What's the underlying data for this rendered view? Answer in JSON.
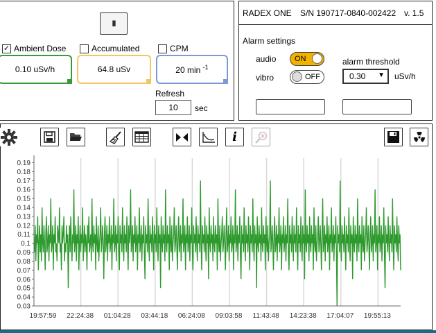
{
  "controls": {
    "pause_label": "II",
    "ambient": {
      "label": "Ambient Dose",
      "checked": true,
      "value": "0.10 uSv/h"
    },
    "accumulated": {
      "label": "Accumulated",
      "checked": false,
      "value": "64.8 uSv"
    },
    "cpm": {
      "label": "CPM",
      "checked": false,
      "value": "20 min",
      "value_sup": "-1"
    },
    "refresh": {
      "label": "Refresh",
      "value": "10",
      "unit": "sec"
    }
  },
  "device": {
    "name": "RADEX ONE",
    "serial": "S/N 190717-0840-002422",
    "version": "v. 1.5"
  },
  "alarm": {
    "title": "Alarm settings",
    "audio_label": "audio",
    "audio_state": "ON",
    "vibro_label": "vibro",
    "vibro_state": "OFF",
    "threshold_label": "alarm threshold",
    "threshold_value": "0.30",
    "threshold_unit": "uSv/h"
  },
  "toolbar": {
    "icons": [
      "gear-icon",
      "save-icon",
      "open-folder-icon",
      "broom-icon",
      "table-icon",
      "fit-icon",
      "curve-icon",
      "info-icon",
      "zoom-reset-icon",
      "save-dark-icon",
      "radiation-icon"
    ]
  },
  "colors": {
    "series": "#2e9a2e",
    "ambient_border": "#3a9a3a",
    "accum_border": "#f0c860",
    "cpm_border": "#7c9ad6",
    "toggle_on": "#f2b200"
  },
  "chart_data": {
    "type": "line",
    "title": "",
    "xlabel": "",
    "ylabel": "",
    "ylim": [
      0.03,
      0.195
    ],
    "y_ticks": [
      "0.19",
      "0.18",
      "0.17",
      "0.16",
      "0.15",
      "0.14",
      "0.13",
      "0.12",
      "0.11",
      "0.1",
      "0.09",
      "0.08",
      "0.07",
      "0.06",
      "0.05",
      "0.04",
      "0.03"
    ],
    "x_ticks": [
      "19:57:59",
      "22:24:38",
      "01:04:28",
      "03:44:18",
      "06:24:08",
      "09:03:58",
      "11:43:48",
      "14:23:38",
      "17:04:07",
      "19:55:13"
    ],
    "grid": "vertical",
    "series": [
      {
        "values": [
          0.1,
          0.09,
          0.12,
          0.08,
          0.11,
          0.1,
          0.13,
          0.07,
          0.1,
          0.12,
          0.09,
          0.11,
          0.08,
          0.14,
          0.1,
          0.09,
          0.12,
          0.1,
          0.07,
          0.11,
          0.13,
          0.09,
          0.1,
          0.12,
          0.08,
          0.11,
          0.1,
          0.15,
          0.09,
          0.1,
          0.12,
          0.07,
          0.11,
          0.1,
          0.13,
          0.09,
          0.1,
          0.08,
          0.12,
          0.11,
          0.1,
          0.14,
          0.09,
          0.1,
          0.07,
          0.12,
          0.1,
          0.11,
          0.13,
          0.08,
          0.1,
          0.09,
          0.12,
          0.1,
          0.11,
          0.05,
          0.1,
          0.12,
          0.09,
          0.13,
          0.1,
          0.08,
          0.11,
          0.1,
          0.16,
          0.09,
          0.1,
          0.12,
          0.08,
          0.11,
          0.1,
          0.13,
          0.07,
          0.1,
          0.12,
          0.09,
          0.11,
          0.1,
          0.14,
          0.08,
          0.1,
          0.12,
          0.09,
          0.11,
          0.1,
          0.07,
          0.12,
          0.1,
          0.13,
          0.09,
          0.1,
          0.11,
          0.08,
          0.15,
          0.1,
          0.09,
          0.12,
          0.1,
          0.11,
          0.07,
          0.13,
          0.1,
          0.09,
          0.12,
          0.08,
          0.1,
          0.11,
          0.14,
          0.09,
          0.1,
          0.12,
          0.1,
          0.06,
          0.11,
          0.13,
          0.09,
          0.1,
          0.12,
          0.08,
          0.11,
          0.1,
          0.13,
          0.09,
          0.1,
          0.12,
          0.07,
          0.11,
          0.1,
          0.15,
          0.09,
          0.1,
          0.12,
          0.08,
          0.11,
          0.1,
          0.13,
          0.09,
          0.07,
          0.12,
          0.1,
          0.11,
          0.09,
          0.14,
          0.1,
          0.08,
          0.12,
          0.1,
          0.11,
          0.09,
          0.13,
          0.1,
          0.07,
          0.12,
          0.1,
          0.11,
          0.16,
          0.09,
          0.1,
          0.12,
          0.08,
          0.11,
          0.1,
          0.13,
          0.09,
          0.1,
          0.12,
          0.07,
          0.11,
          0.1,
          0.14,
          0.09,
          0.1,
          0.12,
          0.08,
          0.11,
          0.1,
          0.13,
          0.09,
          0.06,
          0.12,
          0.1,
          0.11,
          0.09,
          0.15,
          0.1,
          0.08,
          0.12,
          0.1,
          0.11,
          0.09,
          0.13,
          0.1,
          0.07,
          0.12,
          0.1,
          0.11,
          0.09,
          0.14,
          0.1,
          0.08,
          0.12,
          0.1,
          0.11,
          0.05,
          0.13,
          0.1,
          0.09,
          0.12,
          0.1,
          0.11,
          0.08,
          0.16,
          0.1,
          0.09,
          0.12,
          0.1,
          0.11,
          0.07,
          0.13,
          0.1,
          0.09,
          0.12,
          0.08,
          0.1,
          0.11,
          0.14,
          0.09,
          0.1,
          0.12,
          0.1,
          0.07,
          0.11,
          0.13,
          0.09,
          0.1,
          0.12,
          0.08,
          0.11,
          0.1,
          0.15,
          0.09,
          0.1,
          0.12,
          0.07,
          0.11,
          0.1,
          0.13,
          0.09,
          0.1,
          0.12,
          0.08,
          0.11,
          0.1,
          0.14,
          0.09,
          0.07,
          0.12,
          0.1,
          0.11,
          0.09,
          0.13,
          0.1,
          0.08,
          0.12,
          0.1,
          0.11,
          0.09,
          0.17,
          0.1,
          0.07,
          0.12,
          0.1,
          0.11,
          0.09,
          0.13,
          0.1,
          0.08,
          0.12,
          0.1,
          0.11,
          0.06,
          0.14,
          0.1,
          0.09,
          0.12,
          0.1,
          0.11,
          0.08,
          0.13,
          0.1,
          0.09,
          0.12,
          0.1,
          0.11,
          0.07,
          0.15,
          0.1,
          0.09,
          0.12,
          0.08,
          0.1,
          0.11,
          0.13,
          0.09,
          0.1,
          0.12,
          0.1,
          0.07,
          0.11,
          0.14,
          0.09,
          0.1,
          0.12,
          0.08,
          0.11,
          0.1,
          0.13,
          0.09,
          0.1,
          0.12,
          0.07,
          0.11,
          0.1,
          0.16,
          0.09,
          0.1,
          0.12,
          0.08,
          0.11,
          0.1,
          0.13,
          0.09,
          0.06,
          0.12,
          0.1,
          0.11,
          0.09,
          0.14,
          0.1,
          0.08,
          0.12,
          0.1,
          0.11,
          0.09,
          0.13,
          0.1,
          0.07,
          0.12,
          0.1,
          0.11,
          0.09,
          0.15,
          0.1,
          0.08,
          0.12,
          0.1,
          0.11,
          0.05,
          0.13,
          0.1,
          0.09,
          0.12,
          0.1,
          0.11,
          0.08,
          0.14,
          0.1,
          0.09,
          0.12,
          0.1,
          0.11,
          0.07,
          0.13,
          0.1,
          0.09,
          0.12,
          0.08,
          0.1,
          0.11,
          0.17,
          0.09,
          0.1,
          0.12,
          0.1,
          0.07,
          0.11,
          0.13,
          0.09,
          0.1,
          0.12,
          0.08,
          0.11,
          0.1,
          0.14,
          0.09,
          0.1,
          0.12,
          0.07,
          0.11,
          0.1,
          0.13,
          0.09,
          0.1,
          0.12,
          0.08,
          0.11,
          0.1,
          0.15,
          0.09,
          0.07,
          0.12,
          0.1,
          0.11,
          0.09,
          0.13,
          0.1,
          0.08,
          0.12,
          0.1,
          0.11,
          0.09,
          0.14,
          0.1,
          0.07,
          0.12,
          0.1,
          0.11,
          0.09,
          0.13,
          0.1,
          0.08,
          0.12,
          0.1,
          0.11,
          0.06,
          0.16,
          0.1,
          0.09,
          0.12,
          0.1,
          0.11,
          0.08,
          0.13,
          0.1,
          0.09,
          0.12,
          0.1,
          0.11,
          0.07,
          0.14,
          0.1,
          0.09,
          0.12,
          0.08,
          0.1,
          0.11,
          0.13,
          0.09,
          0.1,
          0.12,
          0.1,
          0.07,
          0.11,
          0.15,
          0.09,
          0.1,
          0.12,
          0.08,
          0.11,
          0.1,
          0.13,
          0.09,
          0.1,
          0.12,
          0.07,
          0.11,
          0.1,
          0.14,
          0.09,
          0.1,
          0.12,
          0.08,
          0.11,
          0.1,
          0.13,
          0.09,
          0.03,
          0.12,
          0.1,
          0.11,
          0.09,
          0.17,
          0.1,
          0.08,
          0.12,
          0.1,
          0.11,
          0.09,
          0.13,
          0.1,
          0.07,
          0.12,
          0.1,
          0.11,
          0.09,
          0.14,
          0.1,
          0.08,
          0.12,
          0.1,
          0.11,
          0.06,
          0.13,
          0.1,
          0.09,
          0.12,
          0.1,
          0.11,
          0.08,
          0.15,
          0.1,
          0.09,
          0.12,
          0.1,
          0.11,
          0.07,
          0.13,
          0.1,
          0.09,
          0.12,
          0.08,
          0.1,
          0.11,
          0.14,
          0.09,
          0.1,
          0.12,
          0.1,
          0.07,
          0.11,
          0.13,
          0.09,
          0.1,
          0.12,
          0.08,
          0.11,
          0.1,
          0.16,
          0.09,
          0.1,
          0.12,
          0.07,
          0.11,
          0.1,
          0.13,
          0.09,
          0.1,
          0.12,
          0.08,
          0.11,
          0.1,
          0.14,
          0.09,
          0.05,
          0.12,
          0.1,
          0.11,
          0.09,
          0.13,
          0.1,
          0.08,
          0.12,
          0.1,
          0.11,
          0.09,
          0.15,
          0.1,
          0.07,
          0.12,
          0.1,
          0.11,
          0.09,
          0.13,
          0.1,
          0.08,
          0.12,
          0.1,
          0.11,
          0.07
        ]
      }
    ]
  }
}
